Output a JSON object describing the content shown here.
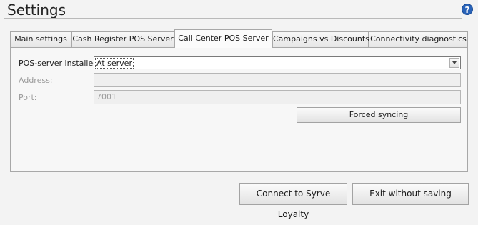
{
  "window": {
    "title": "Settings",
    "help_icon": "?"
  },
  "tabs": [
    {
      "label": "Main settings",
      "active": false
    },
    {
      "label": "Cash Register POS Server",
      "active": false
    },
    {
      "label": "Call Center POS Server",
      "active": true
    },
    {
      "label": "Campaigns vs Discounts",
      "active": false
    },
    {
      "label": "Connectivity diagnostics",
      "active": false
    }
  ],
  "form": {
    "pos_server_label": "POS-server installed:",
    "pos_server_value": "At server",
    "address_label": "Address:",
    "address_value": "",
    "port_label": "Port:",
    "port_value": "7001",
    "forced_sync_label": "Forced syncing"
  },
  "footer": {
    "connect_label": "Connect to Syrve Loyalty",
    "exit_label": "Exit without saving"
  }
}
